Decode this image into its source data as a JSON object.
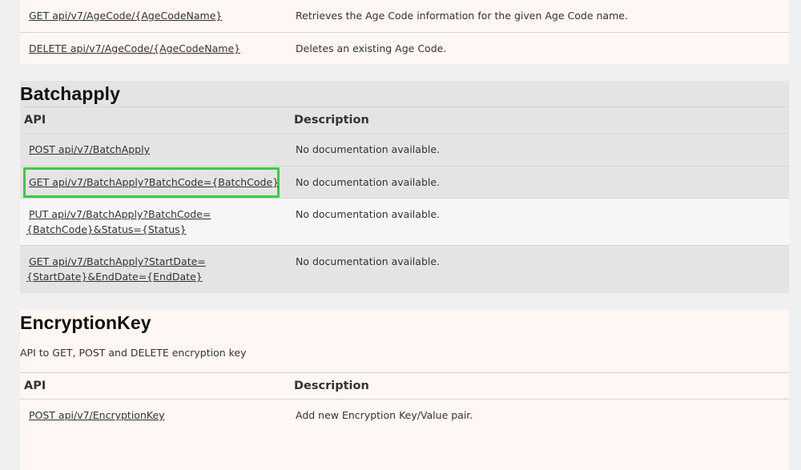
{
  "top_section": {
    "rows": [
      {
        "api": "GET api/v7/AgeCode/{AgeCodeName}",
        "description": "Retrieves the Age Code information for the given Age Code name."
      },
      {
        "api": "DELETE api/v7/AgeCode/{AgeCodeName}",
        "description": "Deletes an existing Age Code."
      }
    ]
  },
  "batchapply": {
    "title": "Batchapply",
    "header_api": "API",
    "header_description": "Description",
    "rows": [
      {
        "api": "POST api/v7/BatchApply",
        "description": "No documentation available."
      },
      {
        "api": "GET api/v7/BatchApply?BatchCode={BatchCode}",
        "description": "No documentation available."
      },
      {
        "api": "PUT api/v7/BatchApply?BatchCode={BatchCode}&Status={Status}",
        "description": "No documentation available."
      },
      {
        "api": "GET api/v7/BatchApply?StartDate={StartDate}&EndDate={EndDate}",
        "description": "No documentation available."
      }
    ]
  },
  "encryptionkey": {
    "title": "EncryptionKey",
    "subtitle": "API to GET, POST and DELETE encryption key",
    "header_api": "API",
    "header_description": "Description",
    "rows": [
      {
        "api": "POST api/v7/EncryptionKey",
        "description": "Add new Encryption Key/Value pair."
      }
    ]
  },
  "colors": {
    "highlight_border": "#3dcc3d",
    "section_light": "#fff7f3",
    "section_gray": "#e4e4e4"
  }
}
